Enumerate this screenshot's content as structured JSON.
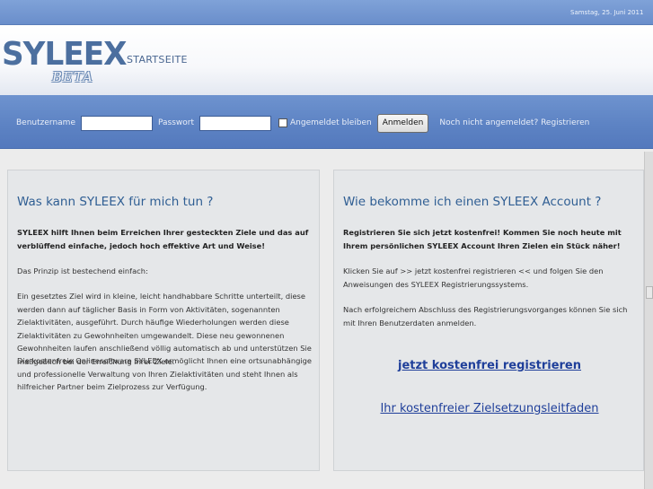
{
  "topbar": {
    "date": "Samstag, 25. Juni 2011"
  },
  "header": {
    "logo_text": "SYLEEX",
    "beta_text": "BETA",
    "nav_startseite": "STARTSEITE"
  },
  "login": {
    "username_label": "Benutzername",
    "username_value": "",
    "password_label": "Passwort",
    "password_value": "",
    "remember_label": "Angemeldet bleiben",
    "login_button": "Anmelden",
    "register_link": "Noch nicht angemeldet? Registrieren"
  },
  "left_panel": {
    "title": "Was kann SYLEEX für mich tun ?",
    "intro_bold": "SYLEEX hilft Ihnen beim Erreichen Ihrer gesteckten Ziele und das auf verblüffend einfache, jedoch hoch effektive Art und Weise!",
    "p2": "Das Prinzip ist bestechend einfach:",
    "p3": "Ein gesetztes Ziel wird in kleine, leicht handhabbare Schritte unterteilt, diese werden dann auf täglicher Basis in Form von Aktivitäten, sogenannten Zielaktivitäten, ausgeführt. Durch häufige Wiederholungen werden diese Zielaktivitäten zu Gewohnheiten umgewandelt. Diese neu gewonnenen Gewohnheiten laufen anschließend völlig automatisch ab und unterstützen Sie maßgeblich bei der Erreichung Ihrer Ziele.",
    "p4": "Die kostenfreie Onlinesoftware SYLEEX ermöglicht Ihnen eine ortsunabhängige und professionelle Verwaltung von Ihren Zielaktivitäten und steht Ihnen als hilfreicher Partner beim Zielprozess zur Verfügung."
  },
  "right_panel": {
    "title": "Wie bekomme ich einen SYLEEX Account ?",
    "intro_bold": "Registrieren Sie sich jetzt kostenfrei! Kommen Sie noch heute mit Ihrem persönlichen SYLEEX Account Ihren Zielen ein Stück näher!",
    "p2": "Klicken Sie auf >> jetzt kostenfrei registrieren << und folgen Sie den Anweisungen des SYLEEX Registrierungssystems.",
    "p3": "Nach erfolgreichem Abschluss des Registrierungsvorganges können Sie sich mit Ihren Benutzerdaten anmelden.",
    "link_register": "jetzt kostenfrei registrieren",
    "link_guide": "Ihr kostenfreier Zielsetzungsleitfaden"
  }
}
